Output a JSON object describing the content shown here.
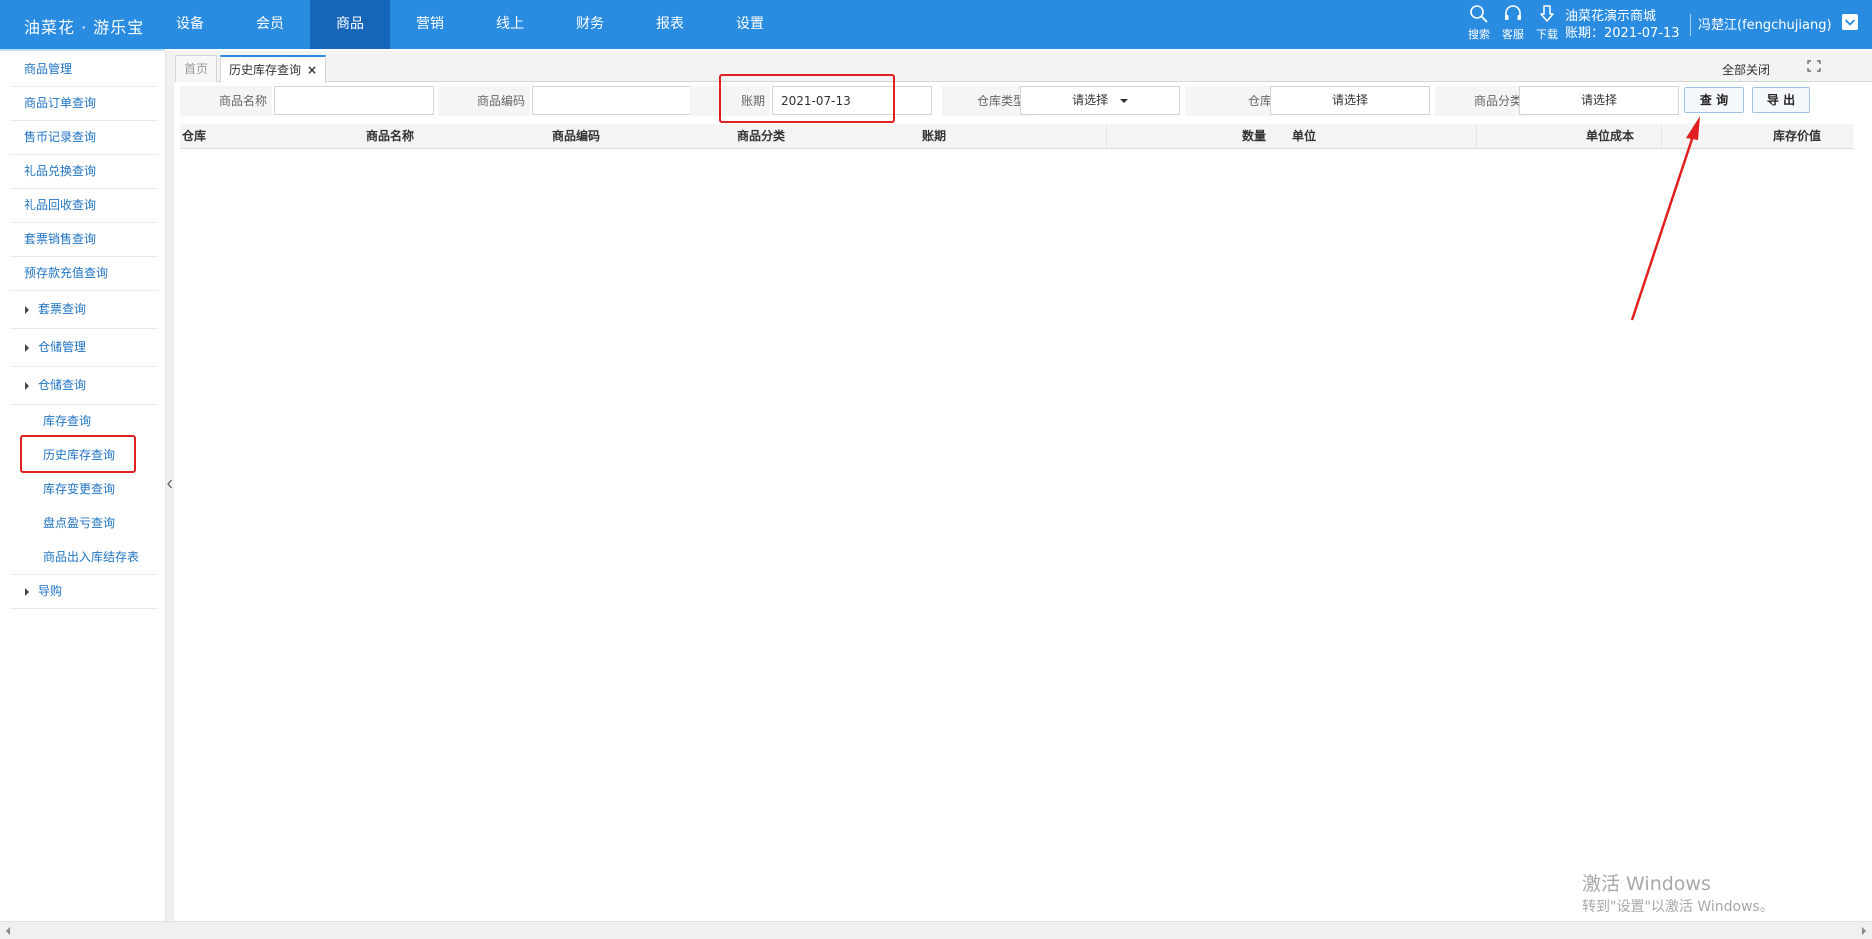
{
  "brand": "油菜花 · 游乐宝",
  "nav": {
    "items": [
      "设备",
      "会员",
      "商品",
      "营销",
      "线上",
      "财务",
      "报表",
      "设置"
    ],
    "active_index": 2
  },
  "tools": {
    "search": "搜索",
    "service": "客服",
    "download": "下载"
  },
  "store": {
    "name": "油菜花演示商城",
    "period": "账期：2021-07-13"
  },
  "user": {
    "name": "冯楚江(fengchujiang)"
  },
  "sidebar": {
    "items": [
      {
        "label": "商品管理"
      },
      {
        "label": "商品订单查询"
      },
      {
        "label": "售币记录查询"
      },
      {
        "label": "礼品兑换查询"
      },
      {
        "label": "礼品回收查询"
      },
      {
        "label": "套票销售查询"
      },
      {
        "label": "预存款充值查询"
      },
      {
        "label": "套票查询"
      },
      {
        "label": "仓储管理"
      },
      {
        "label": "仓储查询"
      },
      {
        "label": "库存查询"
      },
      {
        "label": "历史库存查询"
      },
      {
        "label": "库存变更查询"
      },
      {
        "label": "盘点盈亏查询"
      },
      {
        "label": "商品出入库结存表"
      },
      {
        "label": "导购"
      }
    ]
  },
  "tabs": {
    "home": "首页",
    "current": "历史库存查询",
    "close_glyph": "×",
    "close_all": "全部关闭"
  },
  "filters": {
    "product_name_label": "商品名称",
    "product_code_label": "商品编码",
    "period_label": "账期",
    "period_value": "2021-07-13",
    "warehouse_type_label": "仓库类型:",
    "warehouse_type_value": "请选择",
    "warehouse_label": "仓库",
    "warehouse_value": "请选择",
    "category_label": "商品分类",
    "category_value": "请选择",
    "query_button": "查 询",
    "export_button": "导 出"
  },
  "table": {
    "columns": [
      "仓库",
      "商品名称",
      "商品编码",
      "商品分类",
      "账期",
      "数量",
      "单位",
      "单位成本",
      "库存价值"
    ],
    "rows": []
  },
  "watermark": {
    "line1": "激活 Windows",
    "line2": "转到\"设置\"以激活 Windows。"
  },
  "colors": {
    "topbar": "#2a8ce0",
    "nav_active": "#1565b8",
    "link": "#1f73c2",
    "highlight": "#e02020"
  }
}
